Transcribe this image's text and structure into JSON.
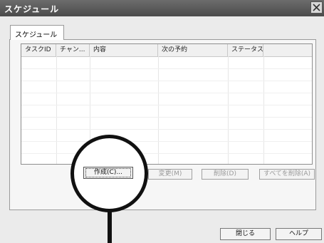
{
  "window": {
    "title": "スケジュール"
  },
  "tabs": [
    {
      "label": "スケジュール"
    }
  ],
  "list": {
    "columns": [
      "タスクID",
      "チャン...",
      "内容",
      "次の予約",
      "ステータス"
    ],
    "rows": []
  },
  "buttons": {
    "create": "作成(C)...",
    "change": "変更(M)",
    "delete": "削除(D)",
    "delete_all": "すべてを削除(A)",
    "close": "閉じる",
    "help": "ヘルプ"
  }
}
